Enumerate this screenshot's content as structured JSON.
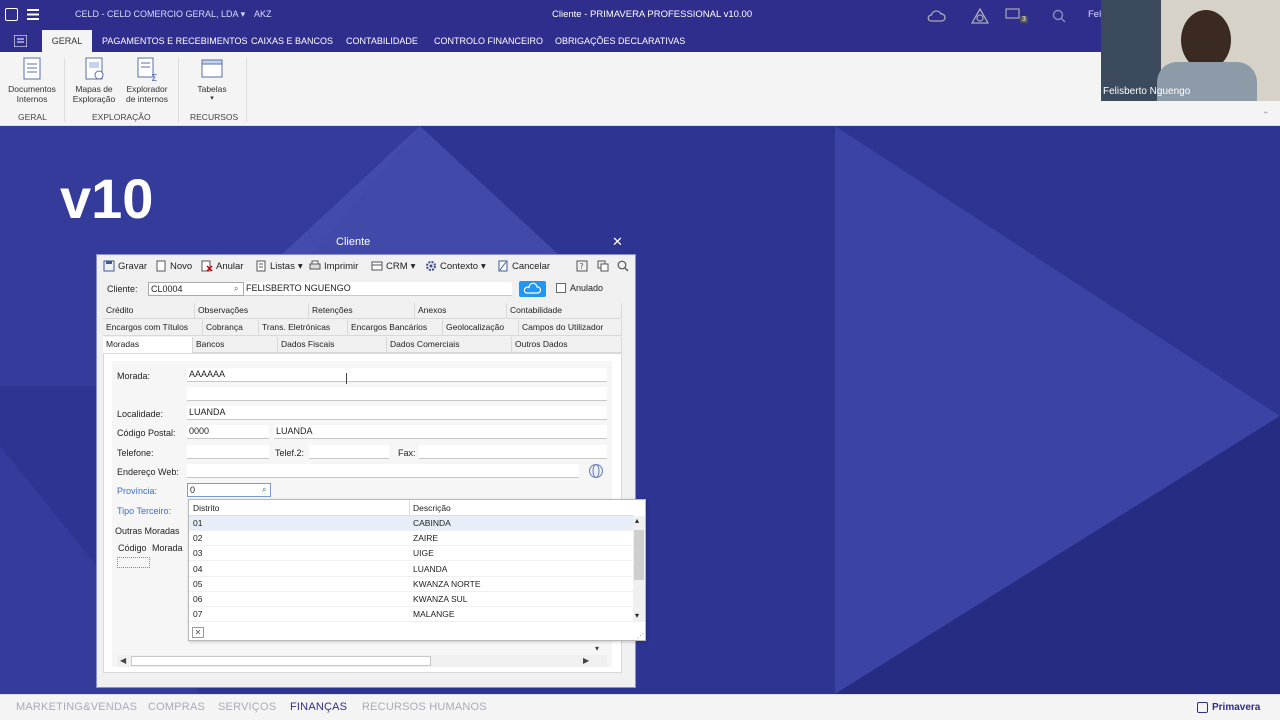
{
  "titlebar": {
    "company": "CELD - CELD COMERCIO GERAL, LDA",
    "currency": "AKZ",
    "window_title": "Cliente - PRIMAVERA PROFESSIONAL v10.00",
    "user_partial": "Feli",
    "messages_count": "3"
  },
  "ribbon_tabs": [
    "GERAL",
    "PAGAMENTOS E RECEBIMENTOS",
    "CAIXAS E BANCOS",
    "CONTABILIDADE",
    "CONTROLO FINANCEIRO",
    "OBRIGAÇÕES DECLARATIVAS"
  ],
  "ribbon": {
    "buttons": [
      {
        "line1": "Documentos",
        "line2": "Internos"
      },
      {
        "line1": "Mapas de",
        "line2": "Exploração"
      },
      {
        "line1": "Explorador",
        "line2": "de internos"
      },
      {
        "line1": "Tabelas",
        "line2": ""
      }
    ],
    "groups": [
      "GERAL",
      "EXPLORAÇÃO",
      "RECURSOS"
    ]
  },
  "webcam": {
    "name": "Felisberto Nguengo"
  },
  "background": {
    "version": "v10"
  },
  "dialog": {
    "title": "Cliente",
    "toolbar": [
      "Gravar",
      "Novo",
      "Anular",
      "Listas",
      "Imprimir",
      "CRM",
      "Contexto",
      "Cancelar"
    ],
    "client_label": "Cliente:",
    "client_code": "CL0004",
    "client_name": "FELISBERTO NGUENGO",
    "anulado_label": "Anulado",
    "tabs_row1": [
      "Crédito",
      "Observações",
      "Retenções",
      "Anexos",
      "Contabilidade"
    ],
    "tabs_row2": [
      "Encargos com Títulos",
      "Cobrança",
      "Trans. Eletrónicas",
      "Encargos Bancários",
      "Geolocalização",
      "Campos do Utilizador"
    ],
    "tabs_row3": [
      "Moradas",
      "Bancos",
      "Dados Fiscais",
      "Dados Comerciais",
      "Outros Dados"
    ],
    "form": {
      "morada_label": "Morada:",
      "morada_value": "AAAAAA",
      "localidade_label": "Localidade:",
      "localidade_value": "LUANDA",
      "codpostal_label": "Código Postal:",
      "codpostal_value": "0000",
      "codpostal_local": "LUANDA",
      "telefone_label": "Telefone:",
      "telef2_label": "Telef.2:",
      "fax_label": "Fax:",
      "web_label": "Endereço Web:",
      "provincia_label": "Província:",
      "provincia_value": "0",
      "tipo_terceiro_label": "Tipo Terceiro:",
      "outras_moradas_label": "Outras Moradas",
      "col_codigo": "Código",
      "col_morada": "Morada"
    },
    "dropdown": {
      "col1": "Distrito",
      "col2": "Descrição",
      "rows": [
        {
          "code": "01",
          "desc": "CABINDA"
        },
        {
          "code": "02",
          "desc": "ZAIRE"
        },
        {
          "code": "03",
          "desc": "UIGE"
        },
        {
          "code": "04",
          "desc": "LUANDA"
        },
        {
          "code": "05",
          "desc": "KWANZA NORTE"
        },
        {
          "code": "06",
          "desc": "KWANZA SUL"
        },
        {
          "code": "07",
          "desc": "MALANGE"
        }
      ]
    }
  },
  "bottombar": {
    "modules": [
      "MARKETING&VENDAS",
      "COMPRAS",
      "SERVIÇOS",
      "FINANÇAS",
      "RECURSOS HUMANOS"
    ],
    "brand": "Primavera"
  },
  "colors": {
    "brand": "#2f2e8c",
    "background": "#2d3492",
    "accent": "#2196f3"
  }
}
